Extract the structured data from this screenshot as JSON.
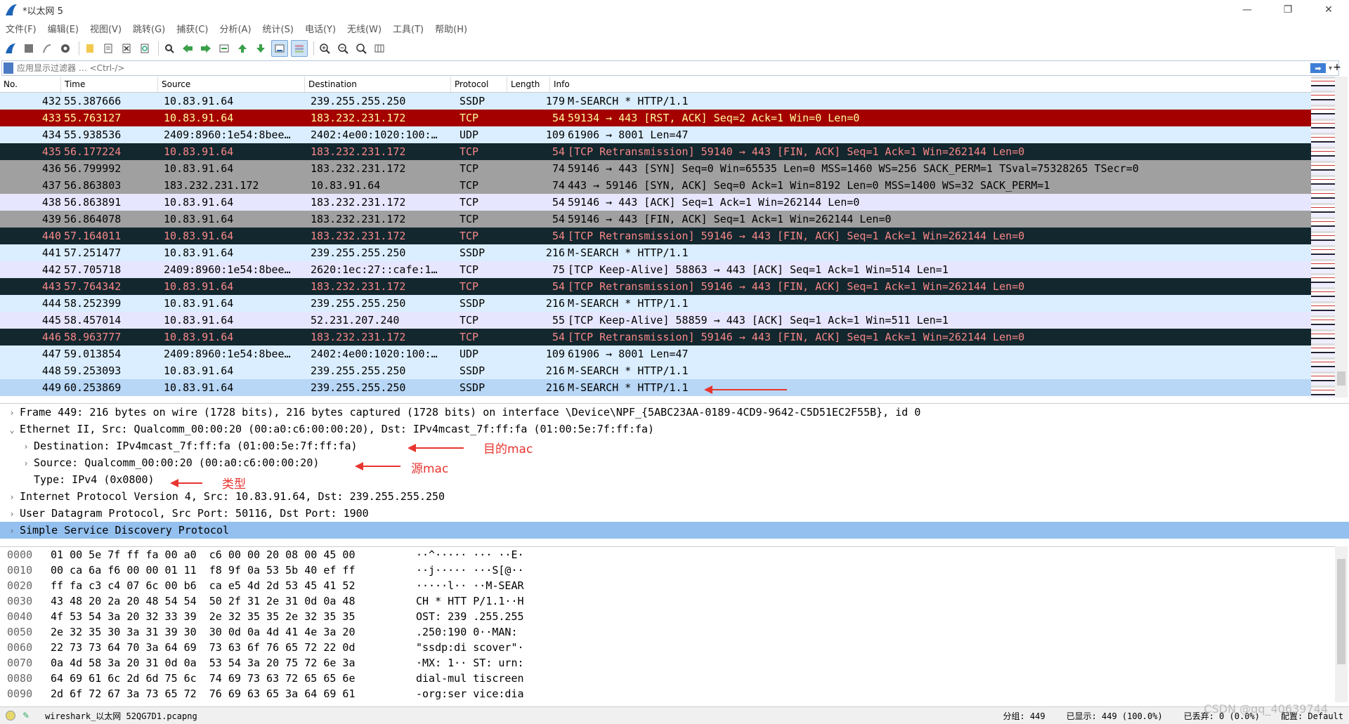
{
  "window": {
    "title": "*以太网 5",
    "controls": [
      "—",
      "❐",
      "✕"
    ]
  },
  "menu": [
    "文件(F)",
    "编辑(E)",
    "视图(V)",
    "跳转(G)",
    "捕获(C)",
    "分析(A)",
    "统计(S)",
    "电话(Y)",
    "无线(W)",
    "工具(T)",
    "帮助(H)"
  ],
  "toolbar_icons": [
    "shark-start-icon",
    "stop-icon",
    "restart-icon",
    "options-icon",
    "open-icon",
    "save-icon",
    "close-file-icon",
    "reload-icon",
    "find-icon",
    "back-icon",
    "forward-icon",
    "goto-icon",
    "first-icon",
    "last-icon",
    "autoscroll-icon",
    "colorize-icon",
    "zoom-in-icon",
    "zoom-out-icon",
    "zoom-reset-icon",
    "resize-columns-icon"
  ],
  "filter": {
    "placeholder": "应用显示过滤器 … <Ctrl-/>"
  },
  "packet_list": {
    "columns": [
      "No.",
      "Time",
      "Source",
      "Destination",
      "Protocol",
      "Length",
      "Info"
    ],
    "rows": [
      {
        "no": "432",
        "time": "55.387666",
        "src": "10.83.91.64",
        "dst": "239.255.255.250",
        "proto": "SSDP",
        "len": "179",
        "info": "M-SEARCH * HTTP/1.1",
        "bg": "#daeeff",
        "fg": "#000000"
      },
      {
        "no": "433",
        "time": "55.763127",
        "src": "10.83.91.64",
        "dst": "183.232.231.172",
        "proto": "TCP",
        "len": "54",
        "info": "59134 → 443 [RST, ACK] Seq=2 Ack=1 Win=0 Len=0",
        "bg": "#a40000",
        "fg": "#fffc9c"
      },
      {
        "no": "434",
        "time": "55.938536",
        "src": "2409:8960:1e54:8bee…",
        "dst": "2402:4e00:1020:100:…",
        "proto": "UDP",
        "len": "109",
        "info": "61906 → 8001 Len=47",
        "bg": "#daeeff",
        "fg": "#000000"
      },
      {
        "no": "435",
        "time": "56.177224",
        "src": "10.83.91.64",
        "dst": "183.232.231.172",
        "proto": "TCP",
        "len": "54",
        "info": "[TCP Retransmission] 59140 → 443 [FIN, ACK] Seq=1 Ack=1 Win=262144 Len=0",
        "bg": "#12272e",
        "fg": "#f78787"
      },
      {
        "no": "436",
        "time": "56.799992",
        "src": "10.83.91.64",
        "dst": "183.232.231.172",
        "proto": "TCP",
        "len": "74",
        "info": "59146 → 443 [SYN] Seq=0 Win=65535 Len=0 MSS=1460 WS=256 SACK_PERM=1 TSval=75328265 TSecr=0",
        "bg": "#a0a0a0",
        "fg": "#000000"
      },
      {
        "no": "437",
        "time": "56.863803",
        "src": "183.232.231.172",
        "dst": "10.83.91.64",
        "proto": "TCP",
        "len": "74",
        "info": "443 → 59146 [SYN, ACK] Seq=0 Ack=1 Win=8192 Len=0 MSS=1400 WS=32 SACK_PERM=1",
        "bg": "#a0a0a0",
        "fg": "#000000"
      },
      {
        "no": "438",
        "time": "56.863891",
        "src": "10.83.91.64",
        "dst": "183.232.231.172",
        "proto": "TCP",
        "len": "54",
        "info": "59146 → 443 [ACK] Seq=1 Ack=1 Win=262144 Len=0",
        "bg": "#e7e6ff",
        "fg": "#000000"
      },
      {
        "no": "439",
        "time": "56.864078",
        "src": "10.83.91.64",
        "dst": "183.232.231.172",
        "proto": "TCP",
        "len": "54",
        "info": "59146 → 443 [FIN, ACK] Seq=1 Ack=1 Win=262144 Len=0",
        "bg": "#a0a0a0",
        "fg": "#000000"
      },
      {
        "no": "440",
        "time": "57.164011",
        "src": "10.83.91.64",
        "dst": "183.232.231.172",
        "proto": "TCP",
        "len": "54",
        "info": "[TCP Retransmission] 59146 → 443 [FIN, ACK] Seq=1 Ack=1 Win=262144 Len=0",
        "bg": "#12272e",
        "fg": "#f78787"
      },
      {
        "no": "441",
        "time": "57.251477",
        "src": "10.83.91.64",
        "dst": "239.255.255.250",
        "proto": "SSDP",
        "len": "216",
        "info": "M-SEARCH * HTTP/1.1",
        "bg": "#daeeff",
        "fg": "#000000"
      },
      {
        "no": "442",
        "time": "57.705718",
        "src": "2409:8960:1e54:8bee…",
        "dst": "2620:1ec:27::cafe:1…",
        "proto": "TCP",
        "len": "75",
        "info": "[TCP Keep-Alive] 58863 → 443 [ACK] Seq=1 Ack=1 Win=514 Len=1",
        "bg": "#e7e6ff",
        "fg": "#000000"
      },
      {
        "no": "443",
        "time": "57.764342",
        "src": "10.83.91.64",
        "dst": "183.232.231.172",
        "proto": "TCP",
        "len": "54",
        "info": "[TCP Retransmission] 59146 → 443 [FIN, ACK] Seq=1 Ack=1 Win=262144 Len=0",
        "bg": "#12272e",
        "fg": "#f78787"
      },
      {
        "no": "444",
        "time": "58.252399",
        "src": "10.83.91.64",
        "dst": "239.255.255.250",
        "proto": "SSDP",
        "len": "216",
        "info": "M-SEARCH * HTTP/1.1",
        "bg": "#daeeff",
        "fg": "#000000"
      },
      {
        "no": "445",
        "time": "58.457014",
        "src": "10.83.91.64",
        "dst": "52.231.207.240",
        "proto": "TCP",
        "len": "55",
        "info": "[TCP Keep-Alive] 58859 → 443 [ACK] Seq=1 Ack=1 Win=511 Len=1",
        "bg": "#e7e6ff",
        "fg": "#000000"
      },
      {
        "no": "446",
        "time": "58.963777",
        "src": "10.83.91.64",
        "dst": "183.232.231.172",
        "proto": "TCP",
        "len": "54",
        "info": "[TCP Retransmission] 59146 → 443 [FIN, ACK] Seq=1 Ack=1 Win=262144 Len=0",
        "bg": "#12272e",
        "fg": "#f78787"
      },
      {
        "no": "447",
        "time": "59.013854",
        "src": "2409:8960:1e54:8bee…",
        "dst": "2402:4e00:1020:100:…",
        "proto": "UDP",
        "len": "109",
        "info": "61906 → 8001 Len=47",
        "bg": "#daeeff",
        "fg": "#000000"
      },
      {
        "no": "448",
        "time": "59.253093",
        "src": "10.83.91.64",
        "dst": "239.255.255.250",
        "proto": "SSDP",
        "len": "216",
        "info": "M-SEARCH * HTTP/1.1",
        "bg": "#daeeff",
        "fg": "#000000"
      },
      {
        "no": "449",
        "time": "60.253869",
        "src": "10.83.91.64",
        "dst": "239.255.255.250",
        "proto": "SSDP",
        "len": "216",
        "info": "M-SEARCH * HTTP/1.1",
        "bg": "#b8d6f5",
        "fg": "#000000"
      }
    ]
  },
  "details": [
    {
      "text": "Frame 449: 216 bytes on wire (1728 bits), 216 bytes captured (1728 bits) on interface \\Device\\NPF_{5ABC23AA-0189-4CD9-9642-C5D51EC2F55B}, id 0",
      "twisty": "›",
      "indent": 0,
      "selected": false
    },
    {
      "text": "Ethernet II, Src: Qualcomm_00:00:20 (00:a0:c6:00:00:20), Dst: IPv4mcast_7f:ff:fa (01:00:5e:7f:ff:fa)",
      "twisty": "⌄",
      "indent": 0,
      "selected": false
    },
    {
      "text": "Destination: IPv4mcast_7f:ff:fa (01:00:5e:7f:ff:fa)",
      "twisty": "›",
      "indent": 1,
      "selected": false
    },
    {
      "text": "Source: Qualcomm_00:00:20 (00:a0:c6:00:00:20)",
      "twisty": "›",
      "indent": 1,
      "selected": false
    },
    {
      "text": "Type: IPv4 (0x0800)",
      "twisty": "",
      "indent": 1,
      "selected": false
    },
    {
      "text": "Internet Protocol Version 4, Src: 10.83.91.64, Dst: 239.255.255.250",
      "twisty": "›",
      "indent": 0,
      "selected": false
    },
    {
      "text": "User Datagram Protocol, Src Port: 50116, Dst Port: 1900",
      "twisty": "›",
      "indent": 0,
      "selected": false
    },
    {
      "text": "Simple Service Discovery Protocol",
      "twisty": "›",
      "indent": 0,
      "selected": true
    }
  ],
  "annotations": {
    "dst_mac": "目的mac",
    "src_mac": "源mac",
    "type": "类型"
  },
  "bytes": [
    {
      "off": "0000",
      "hex": "01 00 5e 7f ff fa 00 a0  c6 00 00 20 08 00 45 00",
      "asc": "··^····· ··· ··E·"
    },
    {
      "off": "0010",
      "hex": "00 ca 6a f6 00 00 01 11  f8 9f 0a 53 5b 40 ef ff",
      "asc": "··j····· ···S[@··"
    },
    {
      "off": "0020",
      "hex": "ff fa c3 c4 07 6c 00 b6  ca e5 4d 2d 53 45 41 52",
      "asc": "·····l·· ··M-SEAR"
    },
    {
      "off": "0030",
      "hex": "43 48 20 2a 20 48 54 54  50 2f 31 2e 31 0d 0a 48",
      "asc": "CH * HTT P/1.1··H"
    },
    {
      "off": "0040",
      "hex": "4f 53 54 3a 20 32 33 39  2e 32 35 35 2e 32 35 35",
      "asc": "OST: 239 .255.255"
    },
    {
      "off": "0050",
      "hex": "2e 32 35 30 3a 31 39 30  30 0d 0a 4d 41 4e 3a 20",
      "asc": ".250:190 0··MAN: "
    },
    {
      "off": "0060",
      "hex": "22 73 73 64 70 3a 64 69  73 63 6f 76 65 72 22 0d",
      "asc": "\"ssdp:di scover\"·"
    },
    {
      "off": "0070",
      "hex": "0a 4d 58 3a 20 31 0d 0a  53 54 3a 20 75 72 6e 3a",
      "asc": "·MX: 1·· ST: urn:"
    },
    {
      "off": "0080",
      "hex": "64 69 61 6c 2d 6d 75 6c  74 69 73 63 72 65 65 6e",
      "asc": "dial-mul tiscreen"
    },
    {
      "off": "0090",
      "hex": "2d 6f 72 67 3a 73 65 72  76 69 63 65 3a 64 69 61",
      "asc": "-org:ser vice:dia"
    }
  ],
  "status": {
    "file": "wireshark_以太网 52QG7D1.pcapng",
    "packets": "分组: 449",
    "displayed": "已显示: 449 (100.0%)",
    "dropped": "已丢弃: 0 (0.0%)",
    "profile": "配置: Default"
  },
  "watermark": "CSDN @qq_40639744"
}
